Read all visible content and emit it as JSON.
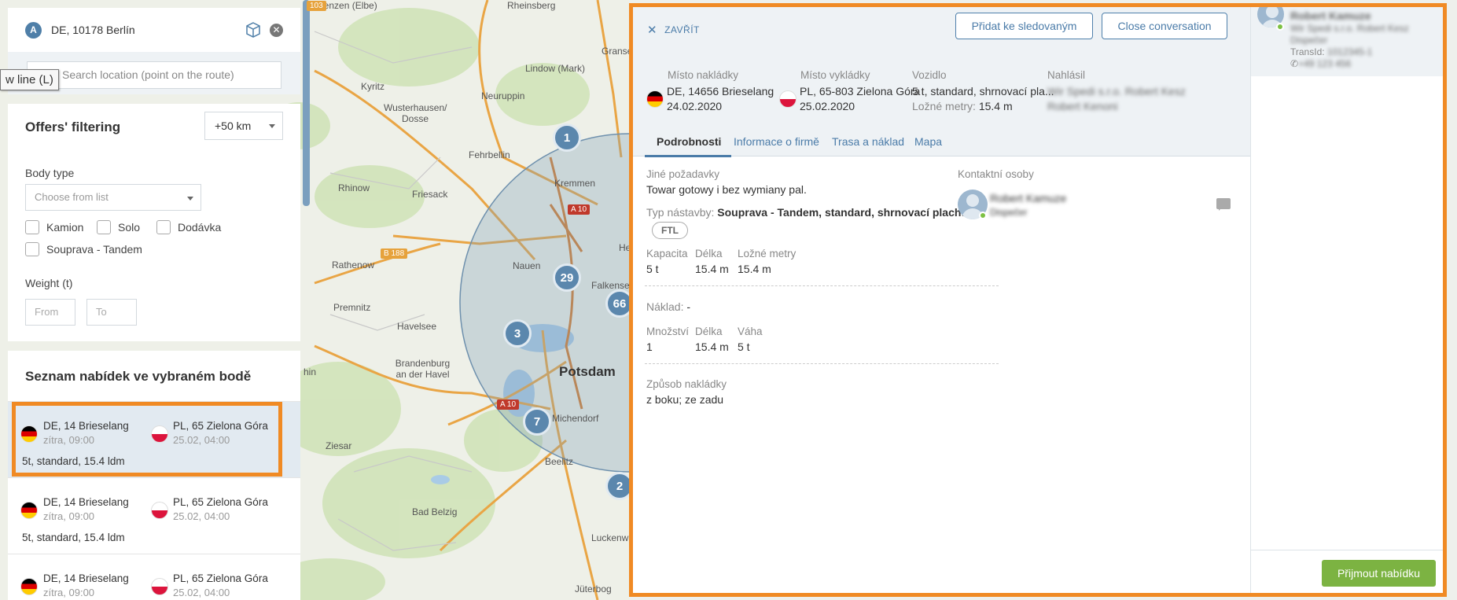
{
  "map": {
    "places": [
      {
        "name": "Lenzen (Elbe)"
      },
      {
        "name": "Rheinsberg"
      },
      {
        "name": "Gransee"
      },
      {
        "name": "Lindow (Mark)"
      },
      {
        "name": "Kyritz"
      },
      {
        "name": "Wusterhausen/ Dosse"
      },
      {
        "name": "Neuruppin"
      },
      {
        "name": "Fehrbellin"
      },
      {
        "name": "Kremmen"
      },
      {
        "name": "Rhinow"
      },
      {
        "name": "Friesack"
      },
      {
        "name": "Rathenow"
      },
      {
        "name": "Nauen"
      },
      {
        "name": "Falkensee"
      },
      {
        "name": "Premnitz"
      },
      {
        "name": "Havelsee"
      },
      {
        "name": "Brandenburg an der Havel"
      },
      {
        "name": "Potsdam"
      },
      {
        "name": "Michendorf"
      },
      {
        "name": "Ziesar"
      },
      {
        "name": "Beelitz"
      },
      {
        "name": "Bad Belzig"
      },
      {
        "name": "Luckenwalde"
      },
      {
        "name": "Jüterbog"
      },
      {
        "name": "He"
      },
      {
        "name": "hin"
      }
    ],
    "road_labels": [
      "103",
      "A 10",
      "B 188",
      "A 10"
    ],
    "clusters": [
      "1",
      "29",
      "3",
      "7",
      "66",
      "2"
    ],
    "tooltip": "w line (L)"
  },
  "route": {
    "badge": "A",
    "address": "DE, 10178 Berlín",
    "search_placeholder": "Search location (point on the route)"
  },
  "filters": {
    "title": "Offers' filtering",
    "radius": "+50 km",
    "body_type_label": "Body type",
    "body_type_placeholder": "Choose from list",
    "options": [
      "Kamion",
      "Solo",
      "Dodávka",
      "Souprava - Tandem"
    ],
    "weight_label": "Weight (t)",
    "from_placeholder": "From",
    "to_placeholder": "To"
  },
  "offers_list": {
    "title": "Seznam nabídek ve vybraném bodě",
    "items": [
      {
        "from": "DE, 14 Brieselang",
        "from_time": "zítra, 09:00",
        "to": "PL, 65 Zielona Góra",
        "to_time": "25.02, 04:00",
        "spec": "5t, standard, 15.4 ldm"
      },
      {
        "from": "DE, 14 Brieselang",
        "from_time": "zítra, 09:00",
        "to": "PL, 65 Zielona Góra",
        "to_time": "25.02, 04:00",
        "spec": "5t, standard, 15.4 ldm"
      },
      {
        "from": "DE, 14 Brieselang",
        "from_time": "zítra, 09:00",
        "to": "PL, 65 Zielona Góra",
        "to_time": "25.02, 04:00",
        "spec": ""
      }
    ]
  },
  "detail": {
    "close_label": "ZAVŘÍT",
    "watch_button": "Přidat ke sledovaným",
    "close_conversation": "Close conversation",
    "loading_label": "Místo nakládky",
    "loading_place": "DE, 14656 Brieselang",
    "loading_date": "24.02.2020",
    "unloading_label": "Místo vykládky",
    "unloading_place": "PL, 65-803 Zielona Góra",
    "unloading_date": "25.02.2020",
    "vehicle_label": "Vozidlo",
    "vehicle_value": "5 t, standard, shrnovací pla...",
    "vehicle_ldm_label": "Ložné metry:",
    "vehicle_ldm_value": "15.4 m",
    "reporter_label": "Nahlásil",
    "reporter_line1": "Wir Spedi s.r.o. Robert Kesz",
    "reporter_line2": "Robert Kenoni",
    "tabs": [
      "Podrobnosti",
      "Informace o firmě",
      "Trasa a náklad",
      "Mapa"
    ],
    "other_req_label": "Jiné požadavky",
    "other_req_value": "Towar gotowy i bez wymiany pal.",
    "body_label": "Typ nástavby:",
    "body_value": "Souprava - Tandem, standard, shrnovací plachta",
    "ftl": "FTL",
    "capacity_label": "Kapacita",
    "capacity_value": "5 t",
    "length_label": "Délka",
    "length_value": "15.4 m",
    "ldm_label": "Ložné metry",
    "ldm_value": "15.4 m",
    "cargo_label": "Náklad:",
    "cargo_value": "-",
    "qty_label": "Množství",
    "qty_value": "1",
    "length2_label": "Délka",
    "length2_value": "15.4 m",
    "weight_label": "Váha",
    "weight_value": "5 t",
    "loading_method_label": "Způsob nakládky",
    "loading_method_value": "z boku; ze zadu",
    "contacts_label": "Kontaktní osoby",
    "contact_name": "Robert Kamuze",
    "contact_sub": "Dispečer",
    "accept_button": "Přijmout nabídku"
  },
  "chat": {
    "name": "Robert Kamuze",
    "company": "Wir Spedi s.r.o. Robert Kesz",
    "status": "Dispečer",
    "transid_label": "TransId:",
    "transid_value": "1012345-1",
    "phone": "+49 123 456"
  }
}
